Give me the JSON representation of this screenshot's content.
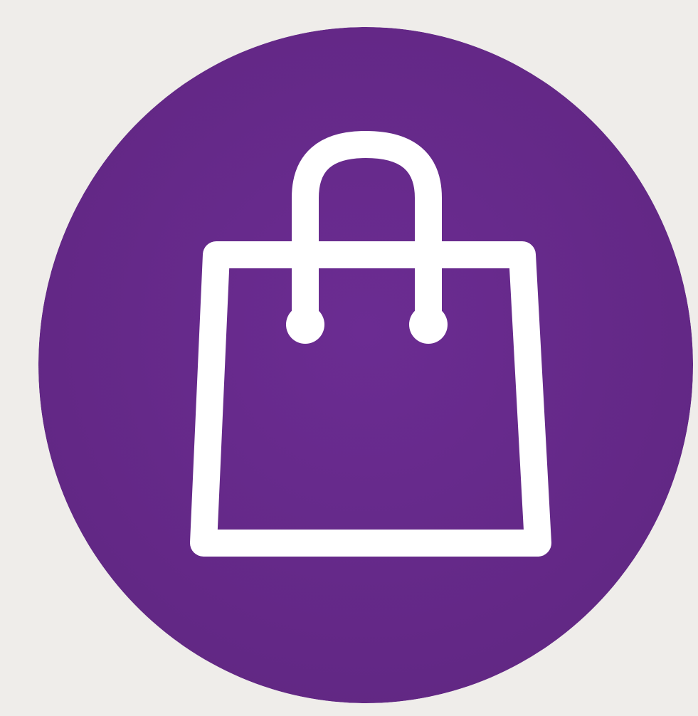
{
  "icon": {
    "name": "shopping-bag-icon",
    "background_color": "#efedea",
    "circle_color": "#6a2a8f",
    "stroke_color": "#ffffff"
  }
}
